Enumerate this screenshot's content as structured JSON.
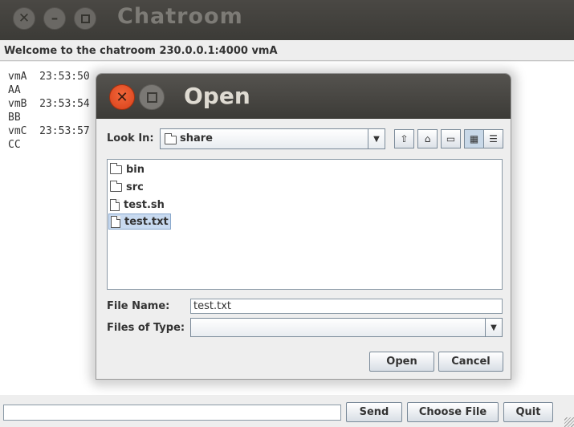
{
  "main_window": {
    "title": "Chatroom",
    "welcome": "Welcome to the chatroom 230.0.0.1:4000 vmA",
    "messages": [
      {
        "user": "vmA",
        "time": "23:53:50",
        "text": "AA"
      },
      {
        "user": "vmB",
        "time": "23:53:54",
        "text": "BB"
      },
      {
        "user": "vmC",
        "time": "23:53:57",
        "text": "CC"
      }
    ],
    "input_value": "",
    "buttons": {
      "send": "Send",
      "choose_file": "Choose File",
      "quit": "Quit"
    }
  },
  "dialog": {
    "title": "Open",
    "look_in_label": "Look In:",
    "look_in_value": "share",
    "files": [
      {
        "name": "bin",
        "type": "folder"
      },
      {
        "name": "src",
        "type": "folder"
      },
      {
        "name": "test.sh",
        "type": "file"
      },
      {
        "name": "test.txt",
        "type": "file",
        "selected": true
      }
    ],
    "file_name_label": "File Name:",
    "file_name_value": "test.txt",
    "files_of_type_label": "Files of Type:",
    "files_of_type_value": "",
    "buttons": {
      "open": "Open",
      "cancel": "Cancel"
    }
  }
}
